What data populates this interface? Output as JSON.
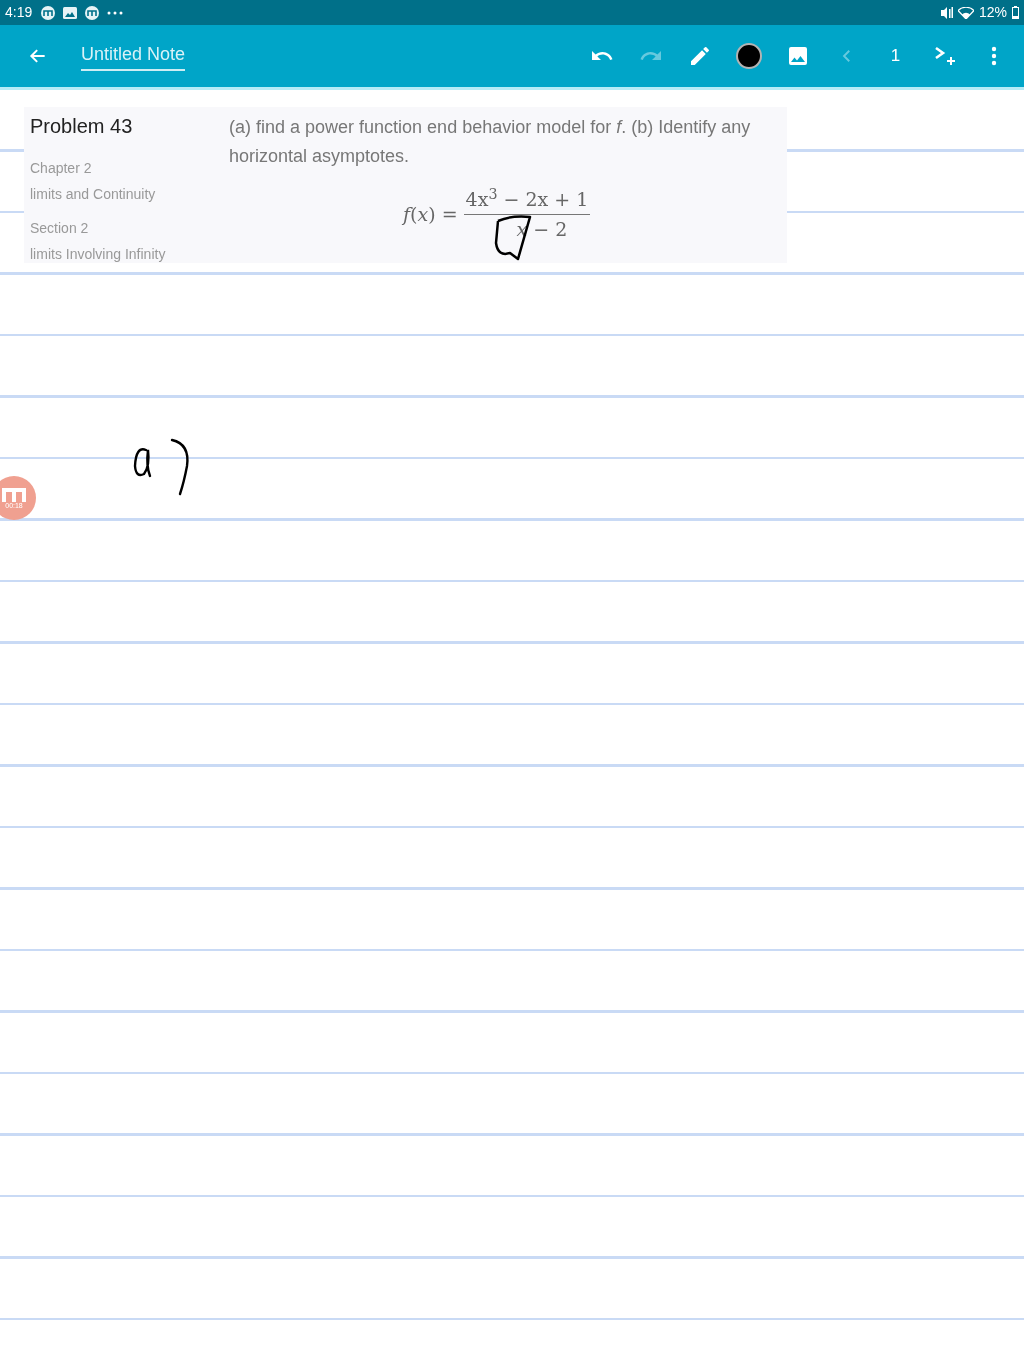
{
  "status_bar": {
    "time": "4:19",
    "battery": "12%"
  },
  "toolbar": {
    "title": "Untitled Note",
    "page": "1",
    "history": [
      {
        "kind": "undo",
        "disabled": false
      },
      {
        "kind": "redo",
        "disabled": true
      }
    ],
    "prev_page": {
      "disabled": true
    }
  },
  "problem": {
    "title": "Problem 43",
    "chapter": "Chapter 2",
    "chapter_name": "limits and Continuity",
    "section": "Section 2",
    "section_name": "limits Involving Infinity",
    "text": "(a) find a power function end behavior model for *f*. (b) Identify any horizontal asymptotes.",
    "formula_lhs": "*f*(*x*) =",
    "numerator": "4x$^{3}$ − 2x + 1",
    "denominator": "*x* − 2"
  },
  "recorder": {
    "timer": "00:18"
  }
}
